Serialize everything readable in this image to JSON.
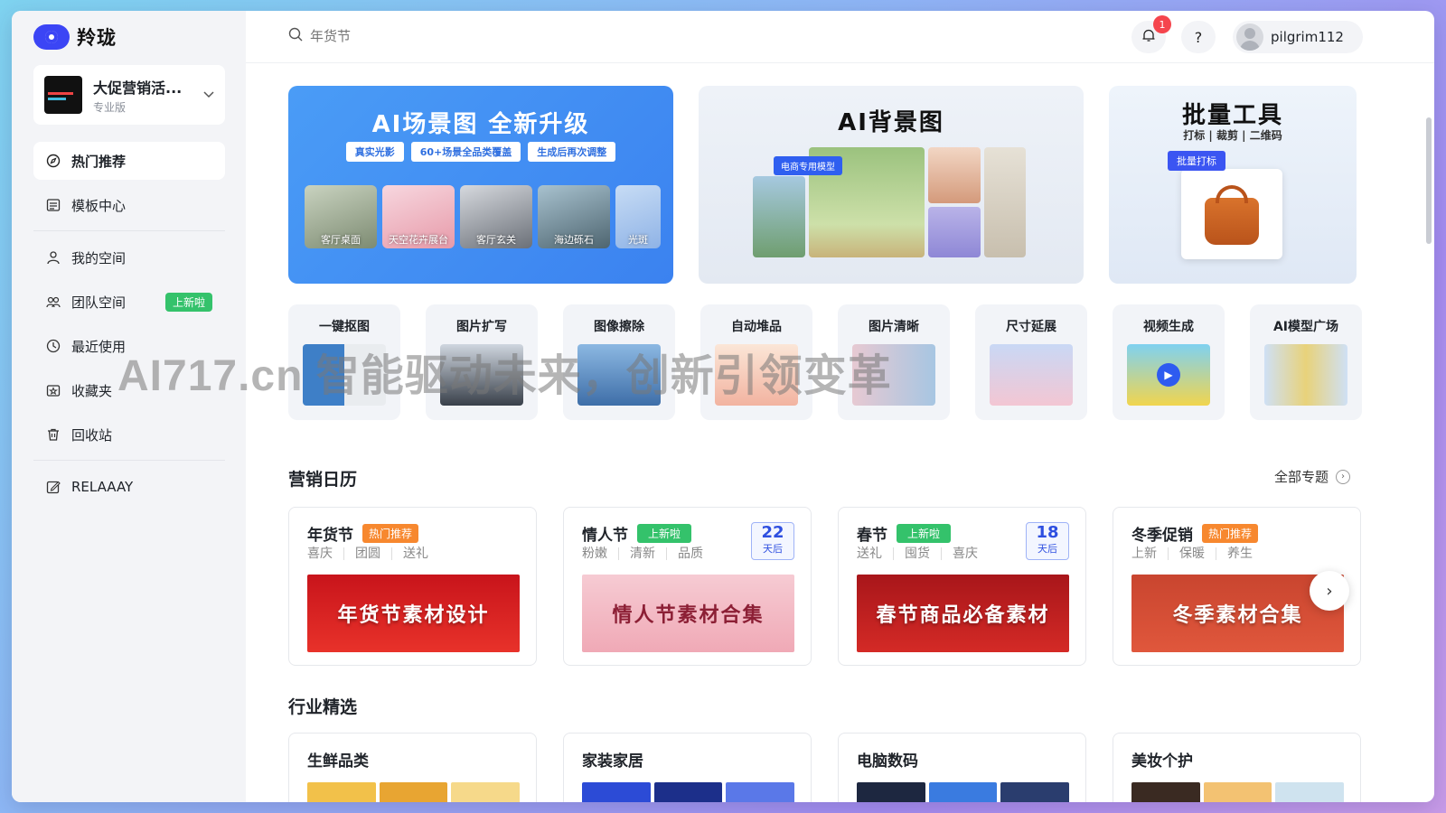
{
  "app": {
    "name": "羚珑"
  },
  "workspace": {
    "name": "大促营销活...",
    "plan": "专业版"
  },
  "sidebar": {
    "items": [
      {
        "label": "热门推荐",
        "icon": "compass-icon",
        "active": true
      },
      {
        "label": "模板中心",
        "icon": "template-icon"
      },
      {
        "label": "我的空间",
        "icon": "user-icon"
      },
      {
        "label": "团队空间",
        "icon": "team-icon",
        "badge": "上新啦"
      },
      {
        "label": "最近使用",
        "icon": "clock-icon"
      },
      {
        "label": "收藏夹",
        "icon": "star-folder-icon"
      },
      {
        "label": "回收站",
        "icon": "trash-icon"
      },
      {
        "label": "RELAAAY",
        "icon": "edit-icon"
      }
    ]
  },
  "search": {
    "placeholder": "年货节"
  },
  "topbar": {
    "notification_count": "1",
    "help": "?",
    "username": "pilgrim112"
  },
  "banners": {
    "scene": {
      "title": "AI场景图 全新升级",
      "tags": [
        "真实光影",
        "60+场景全品类覆盖",
        "生成后再次调整"
      ],
      "thumbs": [
        "客厅桌面",
        "天空花卉展台",
        "客厅玄关",
        "海边砾石",
        "光斑"
      ]
    },
    "background": {
      "title": "AI背景图",
      "tag": "电商专用模型"
    },
    "batch": {
      "title": "批量工具",
      "subtitle": "打标 | 裁剪 | 二维码",
      "tag": "批量打标"
    }
  },
  "tools": [
    "一键抠图",
    "图片扩写",
    "图像擦除",
    "自动堆品",
    "图片清晰",
    "尺寸延展",
    "视频生成",
    "AI模型广场"
  ],
  "watermark": "AI717.cn 智能驱动未来，创新引领变革",
  "calendar": {
    "title": "营销日历",
    "more": "全部专题",
    "cards": [
      {
        "name": "年货节",
        "tag": "热门推荐",
        "tag_type": "hot",
        "keywords": [
          "喜庆",
          "团圆",
          "送礼"
        ],
        "banner": "年货节素材设计",
        "color_a": "#c8141b",
        "color_b": "#e8322a"
      },
      {
        "name": "情人节",
        "tag": "上新啦",
        "tag_type": "new",
        "keywords": [
          "粉嫩",
          "清新",
          "品质"
        ],
        "days": "22",
        "days_unit": "天后",
        "banner": "情人节素材合集",
        "color_a": "#f6cbd3",
        "color_b": "#f0a9b6"
      },
      {
        "name": "春节",
        "tag": "上新啦",
        "tag_type": "new",
        "keywords": [
          "送礼",
          "囤货",
          "喜庆"
        ],
        "days": "18",
        "days_unit": "天后",
        "banner": "春节商品必备素材",
        "color_a": "#a8161a",
        "color_b": "#d42a26"
      },
      {
        "name": "冬季促销",
        "tag": "热门推荐",
        "tag_type": "hot",
        "keywords": [
          "上新",
          "保暖",
          "养生"
        ],
        "banner": "冬季素材合集",
        "color_a": "#c9452f",
        "color_b": "#e0573c"
      }
    ]
  },
  "industry": {
    "title": "行业精选",
    "cards": [
      "生鲜品类",
      "家装家居",
      "电脑数码",
      "美妆个护"
    ]
  },
  "colors": {
    "accent": "#3b45f5",
    "hot": "#f7882f",
    "new": "#34c26b",
    "banner_blue": "#4a9cf6"
  }
}
